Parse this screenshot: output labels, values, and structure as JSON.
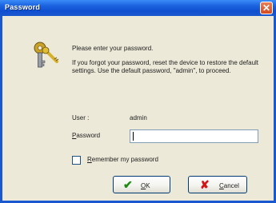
{
  "window": {
    "title": "Password",
    "close_glyph": "✕"
  },
  "dialog": {
    "icon": "keys-icon",
    "intro": "Please enter your password.",
    "forgot": "If you forgot your password, reset the device to restore the default settings. Use the default password, \"admin\", to proceed.",
    "user_label": "User :",
    "user_value": "admin",
    "password_label_first": "P",
    "password_label_rest": "assword",
    "password_value": "",
    "remember_first": "R",
    "remember_rest": "emember my password",
    "remember_checked": false
  },
  "buttons": {
    "ok_icon": "✔",
    "ok_first": "O",
    "ok_rest": "K",
    "cancel_icon": "✘",
    "cancel_first": "C",
    "cancel_rest": "ancel"
  },
  "colors": {
    "title_bar": "#1c63e0",
    "dialog_bg": "#ece9d8",
    "ok_icon": "#1e8a12",
    "cancel_icon": "#d21414"
  }
}
